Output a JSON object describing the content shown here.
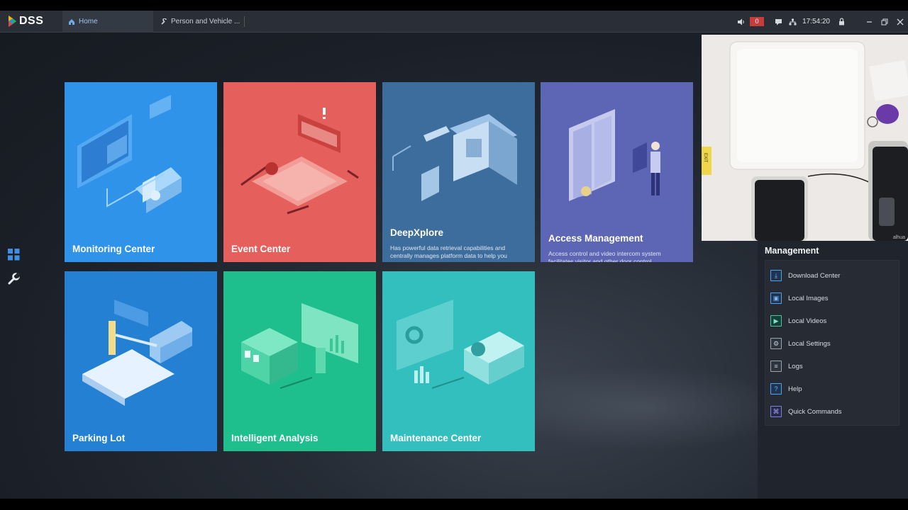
{
  "app": {
    "logo_text": "DSS"
  },
  "tabs": [
    {
      "label": "Home",
      "icon": "home-icon"
    },
    {
      "label": "Person and Vehicle ...",
      "icon": "wrench-icon"
    }
  ],
  "topbar": {
    "alarm_count": "0",
    "time": "17:54:20",
    "icons": [
      "speaker-icon",
      "message-icon",
      "network-icon",
      "lock-icon",
      "minimize-icon",
      "restore-icon",
      "close-icon"
    ]
  },
  "tiles": [
    {
      "name": "Monitoring Center",
      "desc": "",
      "color": "#2f93ea"
    },
    {
      "name": "Event Center",
      "desc": "",
      "color": "#e5605d"
    },
    {
      "name": "DeepXplore",
      "desc": "Has powerful data retrieval capabilities and centrally manages platform data to help you",
      "color": "#3c6d9d"
    },
    {
      "name": "Access Management",
      "desc": "Access control and video intercom system facilitates visitor and other door control",
      "color": "#5c66b4"
    },
    {
      "name": "Parking Lot",
      "desc": "",
      "color": "#2480d2"
    },
    {
      "name": "Intelligent Analysis",
      "desc": "",
      "color": "#1ebf8c"
    },
    {
      "name": "Maintenance Center",
      "desc": "",
      "color": "#34bfbf"
    }
  ],
  "management": {
    "title": "Management",
    "items": [
      {
        "label": "Download Center",
        "icon": "download-icon"
      },
      {
        "label": "Local Images",
        "icon": "image-icon"
      },
      {
        "label": "Local Videos",
        "icon": "video-icon"
      },
      {
        "label": "Local Settings",
        "icon": "settings-icon"
      },
      {
        "label": "Logs",
        "icon": "log-icon"
      },
      {
        "label": "Help",
        "icon": "help-icon"
      },
      {
        "label": "Quick Commands",
        "icon": "command-icon"
      }
    ]
  },
  "camera_overlay": {
    "device_brand": "alhua",
    "exit_label": "EXIT"
  }
}
